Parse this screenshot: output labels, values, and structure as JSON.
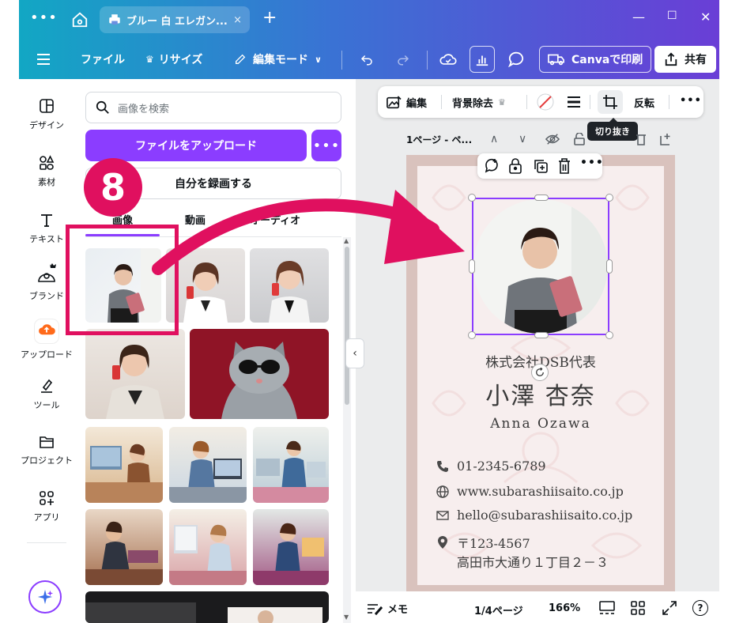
{
  "titlebar": {
    "tab_title": "ブルー 白 エレガン...",
    "tab_close": "×",
    "new_tab": "+",
    "minimize": "—",
    "maximize": "☐",
    "close": "✕"
  },
  "menubar": {
    "file": "ファイル",
    "resize": "リサイズ",
    "edit_mode": "編集モード",
    "print": "Canvaで印刷",
    "share": "共有"
  },
  "rail": {
    "items": [
      {
        "label": "デザイン"
      },
      {
        "label": "素材"
      },
      {
        "label": "テキスト"
      },
      {
        "label": "ブランド"
      },
      {
        "label": "アップロード"
      },
      {
        "label": "ツール"
      },
      {
        "label": "プロジェクト"
      },
      {
        "label": "アプリ"
      }
    ]
  },
  "panel": {
    "search_placeholder": "画像を検索",
    "upload_button": "ファイルをアップロード",
    "upload_more": "•••",
    "record_button": "自分を録画する",
    "tabs": [
      "画像",
      "動画",
      "オーディオ"
    ],
    "collapse": "‹"
  },
  "context_toolbar": {
    "edit": "編集",
    "bg_remove": "背景除去",
    "flip": "反転",
    "more": "•••",
    "tooltip": "切り抜き"
  },
  "page": {
    "label": "1ページ - ペ..."
  },
  "card": {
    "company": "株式会社DSB代表",
    "name_jp": "小澤 杏奈",
    "name_en": "Anna Ozawa",
    "phone": "01-2345-6789",
    "website": "www.subarashiisaito.co.jp",
    "email": "hello@subarashiisaito.co.jp",
    "postal": "〒123-4567",
    "address": "高田市大通り１丁目２－３"
  },
  "statusbar": {
    "memo": "メモ",
    "page_count": "1/4ページ",
    "zoom": "166%",
    "help": "?"
  },
  "annotation": {
    "step_number": "8",
    "accent_color": "#e0105f"
  },
  "colors": {
    "brand_purple": "#8b3dff",
    "gradient_start": "#12a7c4",
    "gradient_end": "#6a3ed6"
  }
}
